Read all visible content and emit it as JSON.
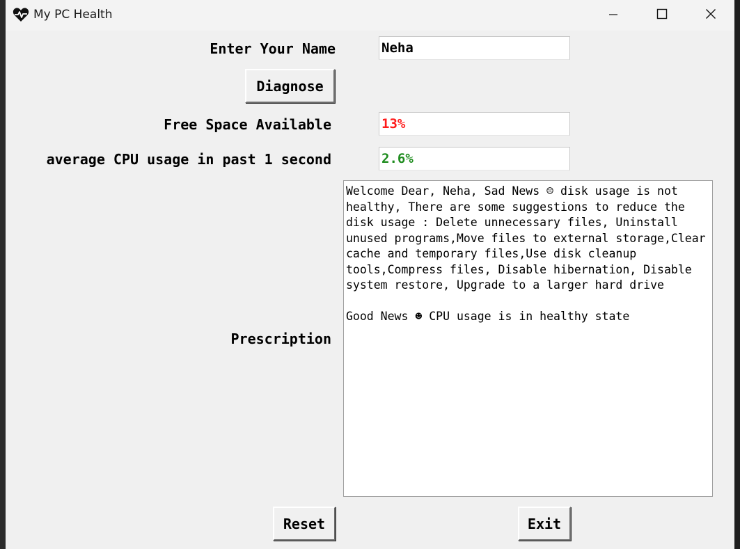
{
  "window": {
    "title": "My PC Health",
    "app_icon": "heart-pulse-icon",
    "controls": [
      "minimize-icon",
      "maximize-icon",
      "close-icon"
    ]
  },
  "form": {
    "name_label": "Enter Your Name",
    "name_value": "Neha",
    "diagnose_label": "Diagnose",
    "free_space_label": "Free Space Available",
    "free_space_value": "13%",
    "free_space_color": "#ff1a1a",
    "cpu_label": "average CPU usage in past 1 second",
    "cpu_value": "2.6%",
    "cpu_color": "#1e8c1e",
    "prescription_label": "Prescription",
    "prescription_text": "Welcome Dear, Neha, Sad News ☹ disk usage is not healthy, There are some suggestions to reduce the disk usage : Delete unnecessary files, Uninstall unused programs,Move files to external storage,Clear cache and temporary files,Use disk cleanup tools,Compress files, Disable hibernation, Disable system restore, Upgrade to a larger hard drive\n\nGood News ☻ CPU usage is in healthy state"
  },
  "actions": {
    "reset_label": "Reset",
    "exit_label": "Exit"
  }
}
